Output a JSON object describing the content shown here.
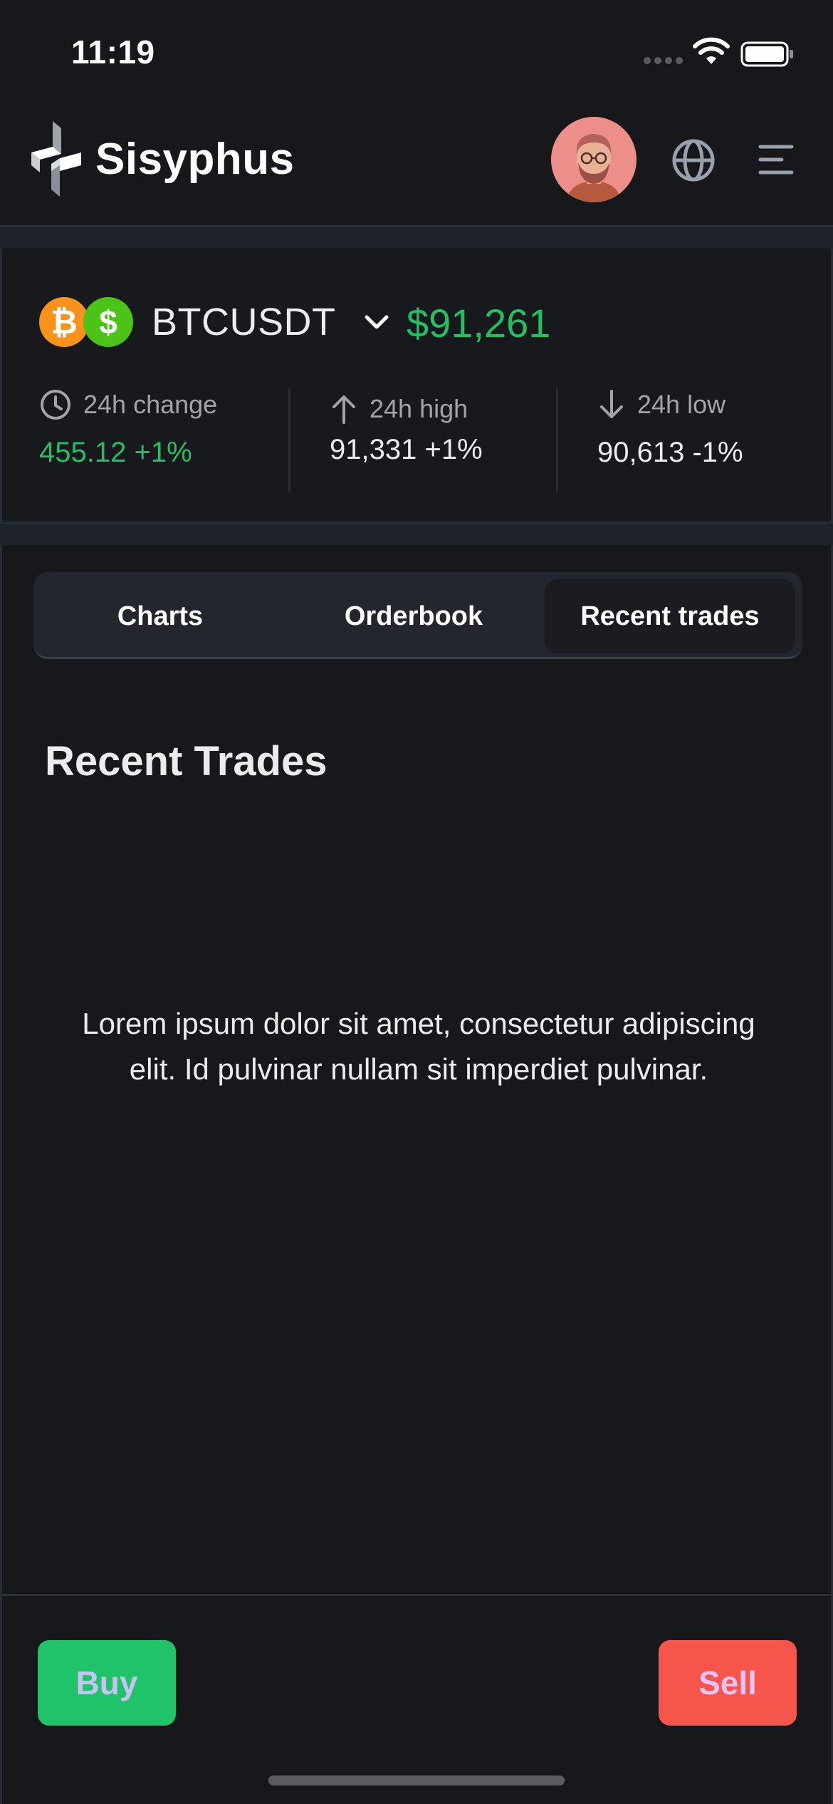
{
  "status_bar": {
    "time": "11:19"
  },
  "header": {
    "brand": "Sisyphus",
    "icons": [
      "logo-icon",
      "avatar",
      "globe-icon",
      "menu-icon"
    ]
  },
  "ticker": {
    "coin_icons": [
      "bitcoin-icon",
      "dollar-icon"
    ],
    "btc_symbol": "₿",
    "usd_symbol": "$",
    "pair": "BTCUSDT",
    "price": "$91,261",
    "stats": {
      "change_label": "24h change",
      "change_value": "455.12 +1%",
      "high_label": "24h high",
      "high_value": "91,331 +1%",
      "low_label": "24h low",
      "low_value": "90,613 -1%"
    },
    "colors": {
      "positive": "#22c062",
      "neutral": "#ededf0"
    }
  },
  "tabs": {
    "items": [
      {
        "label": "Charts",
        "active": false
      },
      {
        "label": "Orderbook",
        "active": false
      },
      {
        "label": "Recent trades",
        "active": true
      }
    ]
  },
  "content": {
    "title": "Recent Trades",
    "body": "Lorem ipsum dolor sit amet, consectetur adipiscing elit. Id pulvinar nullam sit imperdiet pulvinar."
  },
  "footer": {
    "buy_label": "Buy",
    "sell_label": "Sell",
    "buy_color": "#20c26a",
    "sell_color": "#f6554c"
  }
}
